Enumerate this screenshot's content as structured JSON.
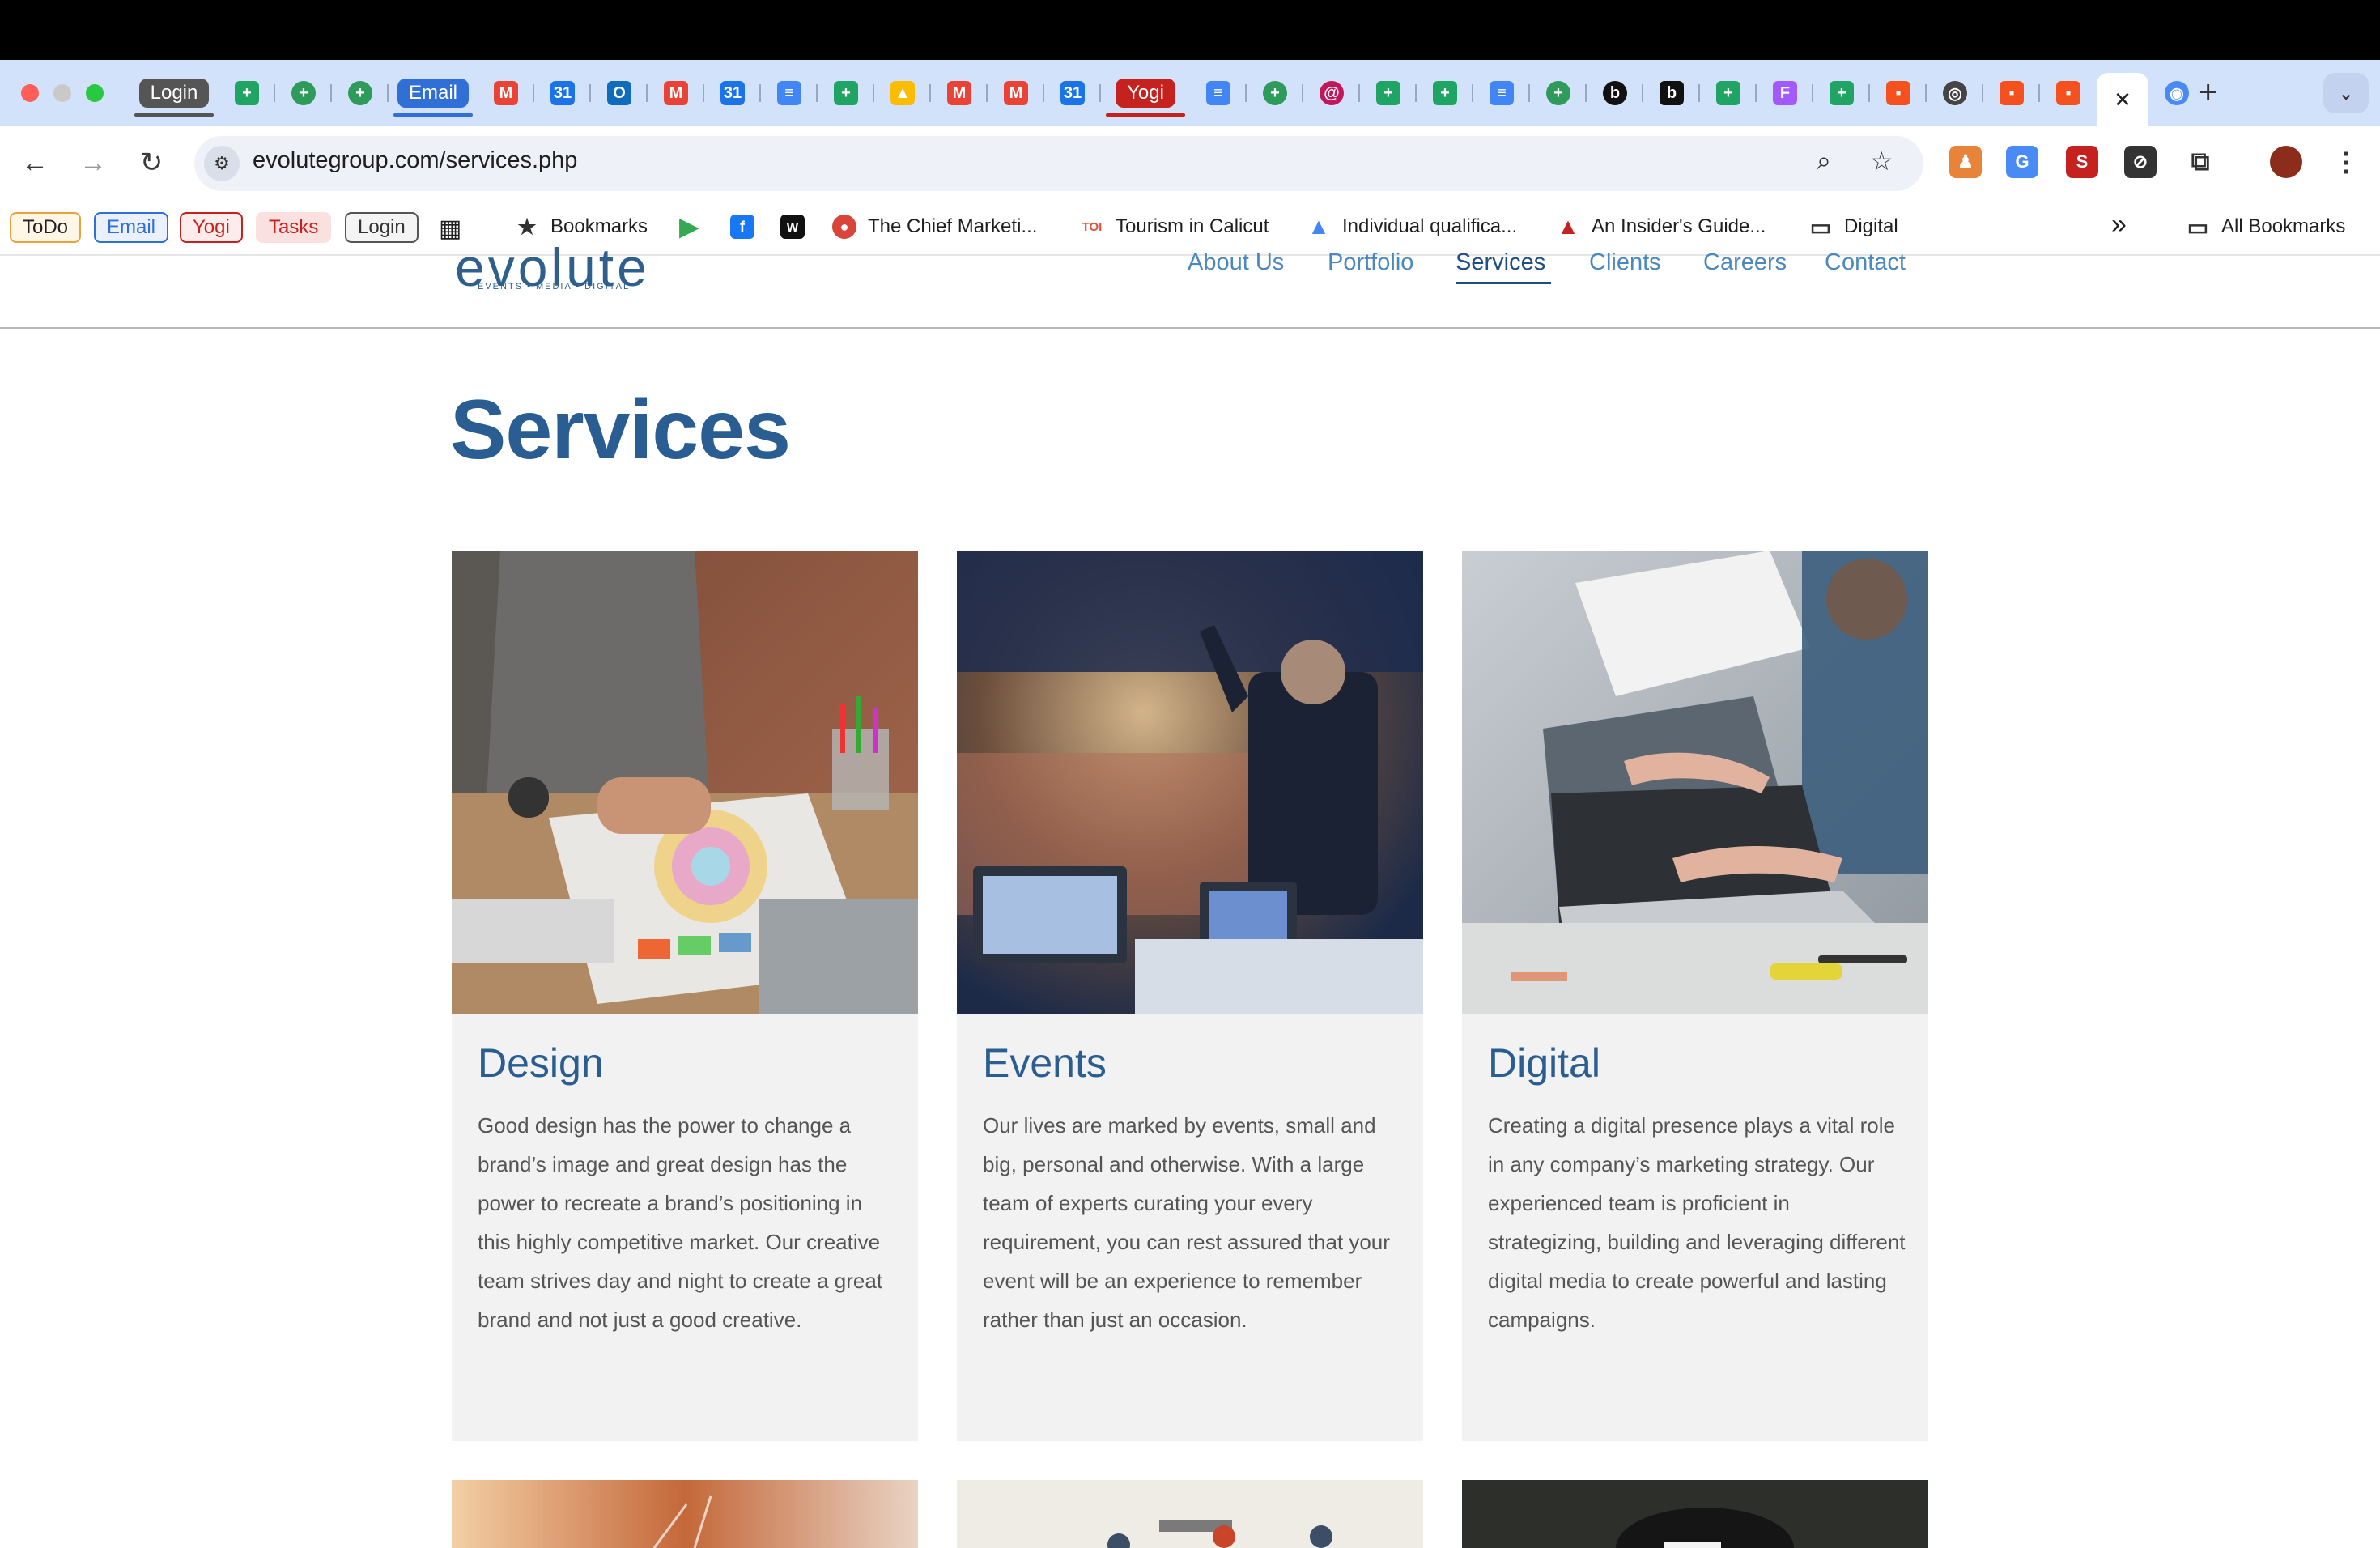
{
  "browser": {
    "tabs": {
      "login_pill": "Login",
      "email_pill": "Email",
      "yogi_pill": "Yogi",
      "close_glyph": "✕",
      "new_tab": "+",
      "menu_glyph": "⌄"
    },
    "url": "evolutegroup.com/services.php",
    "bookmarks": {
      "todo": "ToDo",
      "email": "Email",
      "yogi": "Yogi",
      "tasks": "Tasks",
      "login": "Login",
      "bookmarks": "Bookmarks",
      "chief": "The Chief Marketi...",
      "toi_icon": "TOI",
      "tourism": "Tourism in Calicut",
      "individual": "Individual qualifica...",
      "insider": "An Insider's Guide...",
      "digital": "Digital",
      "more": "»",
      "all": "All Bookmarks"
    }
  },
  "site": {
    "logo": "evolute",
    "tagline": "EVENTS • MEDIA • DIGITAL",
    "nav": [
      "About Us",
      "Portfolio",
      "Services",
      "Clients",
      "Careers",
      "Contact"
    ],
    "active_nav": "Services",
    "page_title": "Services",
    "cards": [
      {
        "title": "Design",
        "text": "Good design has the power to change a brand’s image and great design has the power to recreate a brand’s positioning in this highly competitive market. Our creative team strives day and night to create a great brand and not just a good creative."
      },
      {
        "title": "Events",
        "text": "Our lives are marked by events, small and big, personal and otherwise. With a large team of experts curating your every requirement, you can rest assured that your event will be an experience to remember rather than just an occasion."
      },
      {
        "title": "Digital",
        "text": "Creating a digital presence plays a vital role in any company’s marketing strategy. Our experienced team is proficient in strategizing, building and leveraging different digital media to create powerful and lasting campaigns."
      }
    ]
  },
  "colors": {
    "brand_blue": "#2a5d91",
    "nav_link": "#4b88bd",
    "card_bg": "#f2f2f2",
    "tab_strip": "#d3e2fb"
  }
}
